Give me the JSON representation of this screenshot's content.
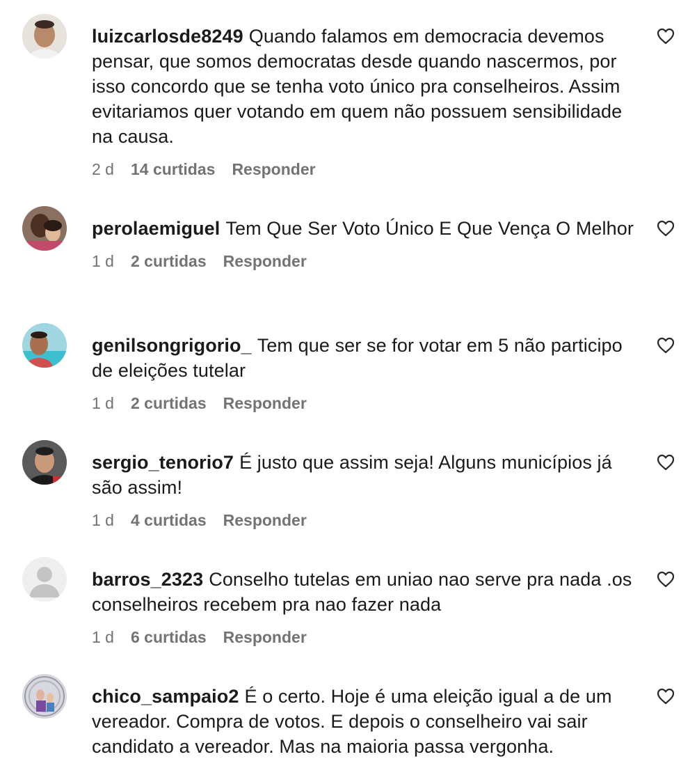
{
  "comments": [
    {
      "username": "luizcarlosde8249",
      "text": "Quando falamos em democracia devemos pensar, que somos democratas desde quando nascermos, por isso concordo que se tenha voto único pra conselheiros. Assim evitariamos quer votando em quem não possuem sensibilidade na causa.",
      "time": "2 d",
      "likes": "14 curtidas",
      "reply": "Responder"
    },
    {
      "username": "perolaemiguel",
      "text": "Tem Que Ser Voto Único E Que Vença O Melhor",
      "time": "1 d",
      "likes": "2 curtidas",
      "reply": "Responder"
    },
    {
      "username": "genilsongrigorio_",
      "text": "Tem que ser se for votar em 5 não participo de eleições tutelar",
      "time": "1 d",
      "likes": "2 curtidas",
      "reply": "Responder"
    },
    {
      "username": "sergio_tenorio7",
      "text": "É justo que assim seja! Alguns municípios já são assim!",
      "time": "1 d",
      "likes": "4 curtidas",
      "reply": "Responder"
    },
    {
      "username": "barros_2323",
      "text": "Conselho tutelas em uniao nao serve pra nada .os conselheiros recebem pra nao fazer nada",
      "time": "1 d",
      "likes": "6 curtidas",
      "reply": "Responder"
    },
    {
      "username": "chico_sampaio2",
      "text": "É o certo. Hoje é uma eleição igual a de um vereador. Compra de votos. E depois o conselheiro vai sair candidato a vereador. Mas na maioria passa vergonha.",
      "time": "",
      "likes": "",
      "reply": ""
    }
  ],
  "icons": {
    "like": "heart-outline-icon",
    "default_avatar": "default-avatar-icon"
  },
  "colors": {
    "text": "#1a1a1a",
    "meta": "#737373",
    "background": "#ffffff"
  }
}
